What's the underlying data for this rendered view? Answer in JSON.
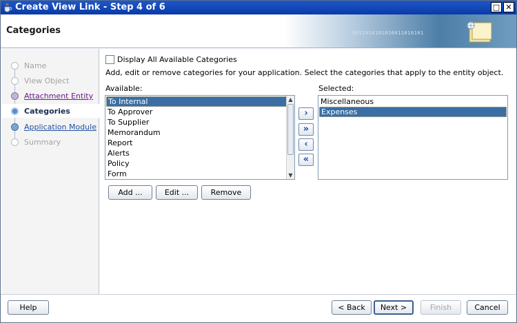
{
  "window": {
    "title": "Create View Link - Step 4 of 6",
    "maximize_glyph": "□",
    "close_glyph": "✕"
  },
  "header": {
    "page_title": "Categories",
    "binary_text": "0011010101010011010101",
    "icon": "folder-wizard-icon"
  },
  "train": [
    {
      "label": "Name",
      "state": "disabled"
    },
    {
      "label": "View Object",
      "state": "disabled"
    },
    {
      "label": "Attachment Entity",
      "state": "visited"
    },
    {
      "label": "Categories",
      "state": "current"
    },
    {
      "label": "Application Module",
      "state": "link"
    },
    {
      "label": "Summary",
      "state": "disabled"
    }
  ],
  "content": {
    "checkbox_label": "Display All Available Categories",
    "checkbox_checked": false,
    "instructions": "Add, edit or remove categories for your application. Select the categories that apply to the entity object.",
    "available_label": "Available:",
    "selected_label": "Selected:",
    "available_items": [
      "To Internal",
      "To Approver",
      "To Supplier",
      "Memorandum",
      "Report",
      "Alerts",
      "Policy",
      "Form"
    ],
    "available_selected_index": 0,
    "selected_items": [
      "Miscellaneous",
      "Expenses"
    ],
    "selected_selected_index": 1,
    "shuttle": {
      "move": "›",
      "move_all": "»",
      "remove": "‹",
      "remove_all": "«"
    },
    "add_label": "Add ...",
    "edit_label": "Edit ...",
    "remove_label": "Remove"
  },
  "footer": {
    "help_label": "Help",
    "back_label": "< Back",
    "next_label": "Next >",
    "finish_label": "Finish",
    "cancel_label": "Cancel"
  }
}
